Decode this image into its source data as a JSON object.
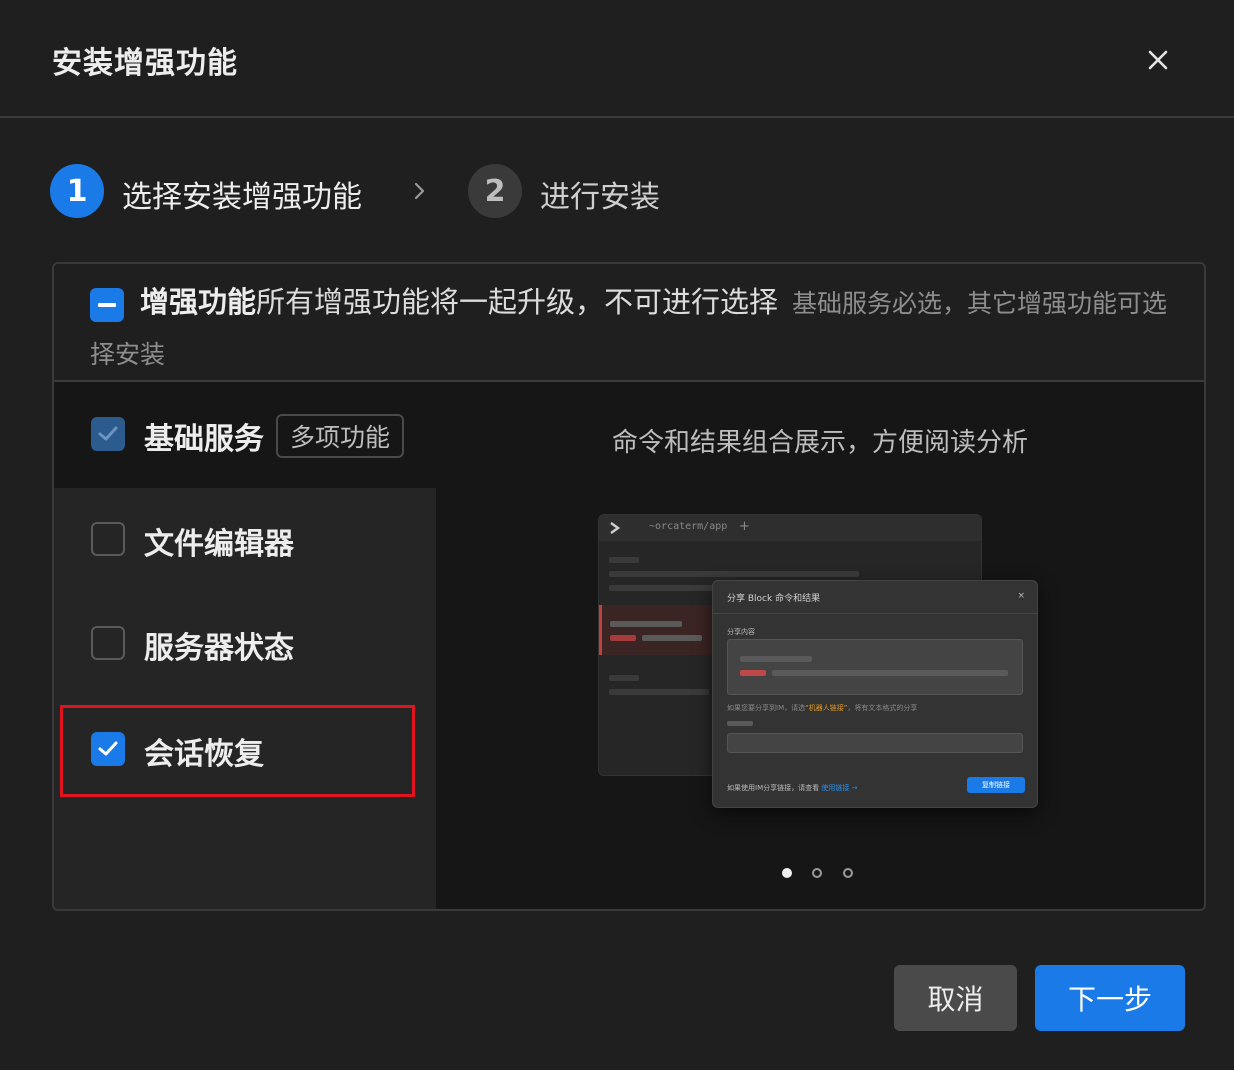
{
  "dialog": {
    "title": "安装增强功能"
  },
  "steps": [
    {
      "number": "1",
      "label": "选择安装增强功能"
    },
    {
      "number": "2",
      "label": "进行安装"
    }
  ],
  "panel_header": {
    "strong": "增强功能",
    "main": "所有增强功能将一起升级，不可进行选择",
    "sub": "基础服务必选，其它增强功能可选择安装"
  },
  "features": [
    {
      "label": "基础服务",
      "tag": "多项功能",
      "checked": true,
      "disabled": true
    },
    {
      "label": "文件编辑器",
      "checked": false
    },
    {
      "label": "服务器状态",
      "checked": false
    },
    {
      "label": "会话恢复",
      "checked": true
    }
  ],
  "preview": {
    "caption": "命令和结果组合展示，方便阅读分析",
    "mock": {
      "tab_path": "~orcaterm/app",
      "plus": "+",
      "modal_title": "分享 Block 命令和结果",
      "modal_close": "×",
      "share_label": "分享内容",
      "note_prefix": "如果您要分享到IM，请选",
      "note_highlight": "“机器人链接”",
      "note_suffix": "，将有文本格式的分享",
      "footer_text": "如果使用IM分享链接，请查看",
      "footer_link": "使用链接 →",
      "copy_button": "复制链接"
    },
    "carousel": {
      "total": 3,
      "active": 0
    }
  },
  "buttons": {
    "cancel": "取消",
    "next": "下一步"
  },
  "colors": {
    "accent": "#1a7be8",
    "highlight_border": "#e0141e",
    "background": "#1f1f1f"
  }
}
